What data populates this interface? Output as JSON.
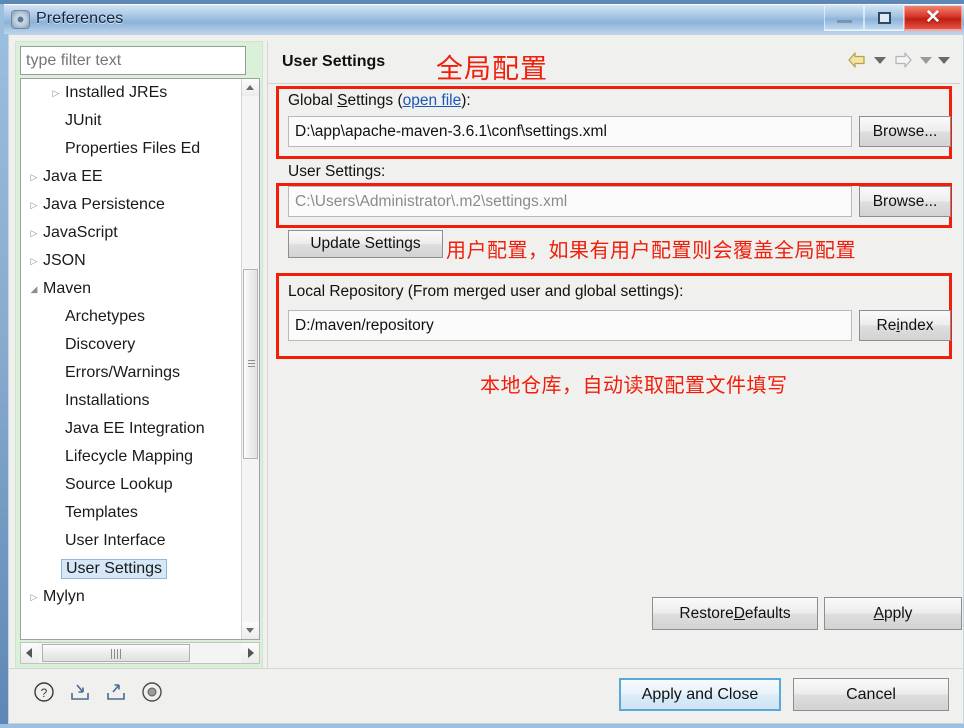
{
  "window": {
    "title": "Preferences",
    "icon": "preferences-gear-icon",
    "buttons": {
      "minimize": "minimize",
      "maximize": "maximize",
      "close": "✕"
    }
  },
  "sidebar": {
    "filter": {
      "value": "",
      "placeholder": "type filter text"
    },
    "items": [
      {
        "label": "Installed JREs",
        "indent": 2,
        "twisty": "collapsed",
        "selected": false
      },
      {
        "label": "JUnit",
        "indent": 2,
        "twisty": "none",
        "selected": false
      },
      {
        "label": "Properties Files Ed",
        "indent": 2,
        "twisty": "none",
        "selected": false
      },
      {
        "label": "Java EE",
        "indent": 1,
        "twisty": "collapsed",
        "selected": false
      },
      {
        "label": "Java Persistence",
        "indent": 1,
        "twisty": "collapsed",
        "selected": false
      },
      {
        "label": "JavaScript",
        "indent": 1,
        "twisty": "collapsed",
        "selected": false
      },
      {
        "label": "JSON",
        "indent": 1,
        "twisty": "collapsed",
        "selected": false
      },
      {
        "label": "Maven",
        "indent": 1,
        "twisty": "expanded",
        "selected": false
      },
      {
        "label": "Archetypes",
        "indent": 2,
        "twisty": "none",
        "selected": false
      },
      {
        "label": "Discovery",
        "indent": 2,
        "twisty": "none",
        "selected": false
      },
      {
        "label": "Errors/Warnings",
        "indent": 2,
        "twisty": "none",
        "selected": false
      },
      {
        "label": "Installations",
        "indent": 2,
        "twisty": "none",
        "selected": false
      },
      {
        "label": "Java EE Integration",
        "indent": 2,
        "twisty": "none",
        "selected": false
      },
      {
        "label": "Lifecycle Mapping",
        "indent": 2,
        "twisty": "none",
        "selected": false
      },
      {
        "label": "Source Lookup",
        "indent": 2,
        "twisty": "none",
        "selected": false
      },
      {
        "label": "Templates",
        "indent": 2,
        "twisty": "none",
        "selected": false
      },
      {
        "label": "User Interface",
        "indent": 2,
        "twisty": "none",
        "selected": false
      },
      {
        "label": "User Settings",
        "indent": 2,
        "twisty": "none",
        "selected": true
      },
      {
        "label": "Mylyn",
        "indent": 1,
        "twisty": "collapsed",
        "selected": false
      }
    ]
  },
  "pane": {
    "title": "User Settings",
    "nav": {
      "back": "back-arrow",
      "back_menu": "back-dropdown",
      "forward": "forward-arrow",
      "forward_menu": "forward-dropdown",
      "view_menu": "view-menu"
    },
    "global_settings": {
      "label_prefix": "Global ",
      "label_mnemonic": "S",
      "label_rest": "ettings (",
      "link": "open file",
      "label_suffix": "):",
      "value": "D:\\app\\apache-maven-3.6.1\\conf\\settings.xml",
      "browse_label": "Browse..."
    },
    "user_settings": {
      "label": "User Settings:",
      "value": "C:\\Users\\Administrator\\.m2\\settings.xml",
      "browse_label": "Browse...",
      "update_label": "Update Settings"
    },
    "local_repository": {
      "label": "Local Repository (From merged user and global settings):",
      "value": "D:/maven/repository",
      "reindex_prefix": "Re",
      "reindex_mnemonic": "i",
      "reindex_suffix": "ndex"
    },
    "page_buttons": {
      "restore_prefix": "Restore ",
      "restore_mnemonic": "D",
      "restore_suffix": "efaults",
      "apply_prefix": "",
      "apply_mnemonic": "A",
      "apply_suffix": "pply"
    }
  },
  "annotations": {
    "color": "#f01e0a",
    "note_global": "全局配置",
    "note_user": "用户配置，如果有用户配置则会覆盖全局配置",
    "note_repo": "本地仓库，自动读取配置文件填写"
  },
  "footer": {
    "icons": [
      "help-icon",
      "import-icon",
      "export-icon",
      "record-icon"
    ],
    "apply_and_close": "Apply and Close",
    "cancel": "Cancel"
  }
}
